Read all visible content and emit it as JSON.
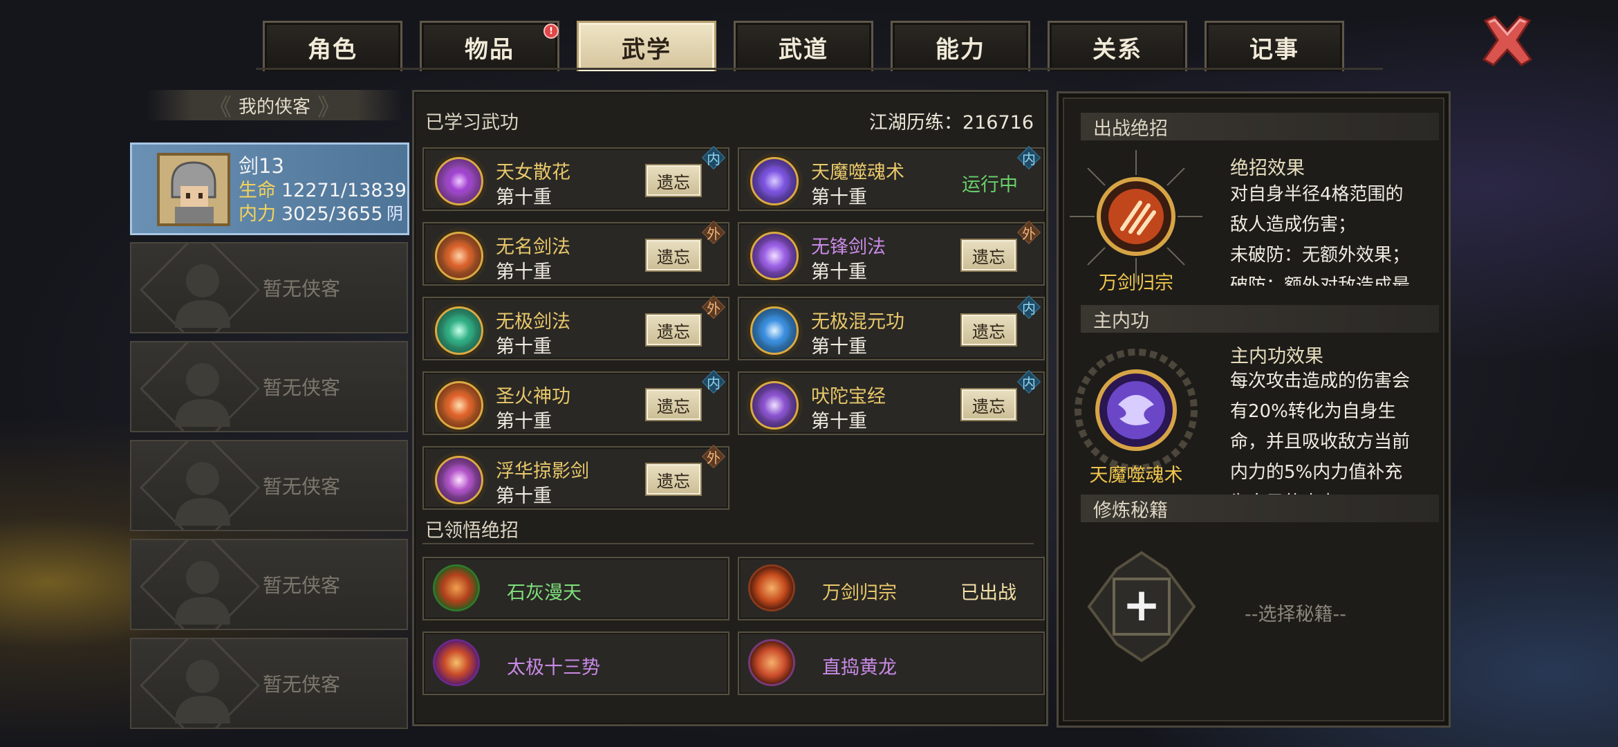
{
  "tabs": [
    {
      "label": "角色"
    },
    {
      "label": "物品",
      "badge": "!"
    },
    {
      "label": "武学"
    },
    {
      "label": "武道"
    },
    {
      "label": "能力"
    },
    {
      "label": "关系"
    },
    {
      "label": "记事"
    }
  ],
  "active_tab": "武学",
  "close_icon": "close-x-icon",
  "left": {
    "title": "我的侠客",
    "hero": {
      "name": "剑13",
      "hp_label": "生命",
      "hp_value": "12271/13839",
      "mp_label": "内力",
      "mp_value": "3025/3655",
      "yin": "阴"
    },
    "empty_slots": [
      "暂无侠客",
      "暂无侠客",
      "暂无侠客",
      "暂无侠客",
      "暂无侠客"
    ]
  },
  "learned": {
    "title": "已学习武功",
    "exp_label": "江湖历练：216716",
    "forget_label": "遗忘",
    "skills": [
      {
        "name": "天女散花",
        "level": "第十重",
        "tag": "内",
        "action": "遗忘",
        "color": "#e8c86a"
      },
      {
        "name": "天魔噬魂术",
        "level": "第十重",
        "tag": "内",
        "action": "运行中",
        "color": "#e8c86a"
      },
      {
        "name": "无名剑法",
        "level": "第十重",
        "tag": "外",
        "action": "遗忘",
        "color": "#e8c86a"
      },
      {
        "name": "无锋剑法",
        "level": "第十重",
        "tag": "外",
        "action": "遗忘",
        "color": "#c98ae6"
      },
      {
        "name": "无极剑法",
        "level": "第十重",
        "tag": "外",
        "action": "遗忘",
        "color": "#e8c86a"
      },
      {
        "name": "无极混元功",
        "level": "第十重",
        "tag": "内",
        "action": "遗忘",
        "color": "#e8c86a"
      },
      {
        "name": "圣火神功",
        "level": "第十重",
        "tag": "内",
        "action": "遗忘",
        "color": "#e8c86a"
      },
      {
        "name": "吠陀宝经",
        "level": "第十重",
        "tag": "内",
        "action": "遗忘",
        "color": "#e8c86a"
      },
      {
        "name": "浮华掠影剑",
        "level": "第十重",
        "tag": "外",
        "action": "遗忘",
        "color": "#e8c86a"
      }
    ]
  },
  "ultimates": {
    "title": "已领悟绝招",
    "items": [
      {
        "name": "石灰漫天",
        "status": "",
        "color": "#7fe07c"
      },
      {
        "name": "万剑归宗",
        "status": "已出战",
        "color": "#e8c86a"
      },
      {
        "name": "太极十三势",
        "status": "",
        "color": "#c98ae6"
      },
      {
        "name": "直捣黄龙",
        "status": "",
        "color": "#c98ae6"
      }
    ]
  },
  "right": {
    "battle_title": "出战绝招",
    "battle_name": "万剑归宗",
    "battle_effect_title": "绝招效果",
    "battle_effect_lines": [
      "对自身半径4格范围的",
      "敌人造成伤害；",
      "未破防：无额外效果；",
      "破防：额外对敌造成最"
    ],
    "inner_title": "主内功",
    "inner_name": "天魔噬魂术",
    "inner_effect_title": "主内功效果",
    "inner_effect_lines": [
      "每次攻击造成的伤害会",
      "有20%转化为自身生",
      "命，并且吸收敌方当前",
      "内力的5%内力值补充",
      "为自己的内力"
    ],
    "manual_title": "修炼秘籍",
    "manual_hint": "--选择秘籍--"
  },
  "colors": {
    "accent_gold": "#e8c86a",
    "running_green": "#68d06a",
    "active_blue": "#5f86ab",
    "tab_active": "#e6dbb9"
  }
}
